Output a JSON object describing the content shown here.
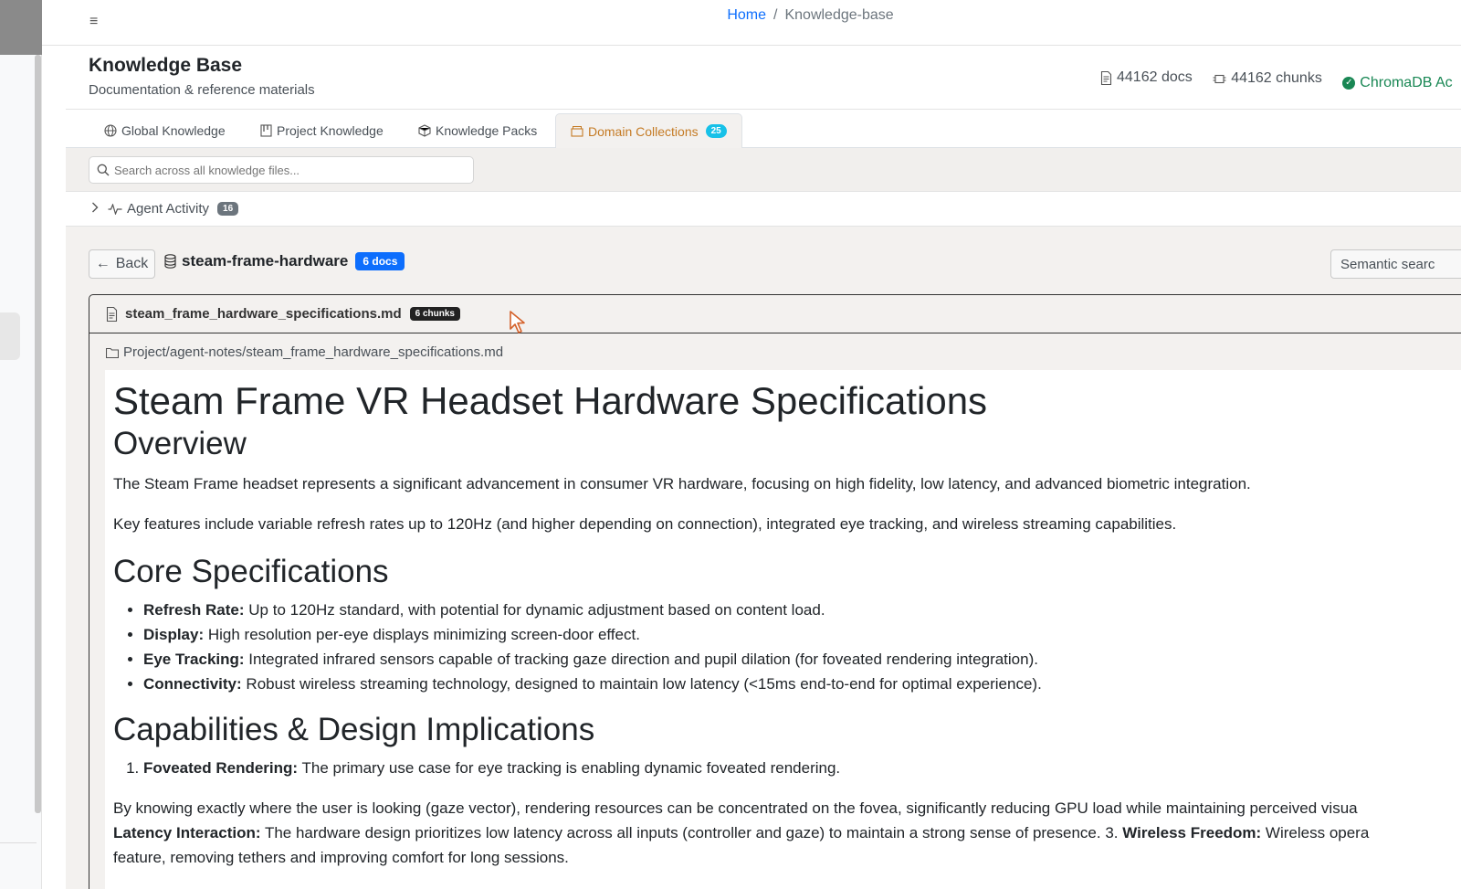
{
  "breadcrumb": {
    "home": "Home",
    "separator": "/",
    "current": "Knowledge-base"
  },
  "header": {
    "title": "Knowledge Base",
    "subtitle": "Documentation & reference materials",
    "docs_stat": "44162 docs",
    "chunks_stat": "44162 chunks",
    "chroma_status": "ChromaDB Ac",
    "status_color": "#198754"
  },
  "tabs": [
    {
      "label": "Global Knowledge",
      "icon": "globe-icon"
    },
    {
      "label": "Project Knowledge",
      "icon": "project-icon"
    },
    {
      "label": "Knowledge Packs",
      "icon": "package-icon"
    },
    {
      "label": "Domain Collections",
      "icon": "archive-icon",
      "count": "25",
      "active": true
    }
  ],
  "search": {
    "placeholder": "Search across all knowledge files..."
  },
  "agent_activity": {
    "label": "Agent Activity",
    "count": "16"
  },
  "collection": {
    "back_label": "Back",
    "name": "steam-frame-hardware",
    "docs_badge": "6 docs",
    "semantic_search_label": "Semantic searc"
  },
  "document": {
    "filename": "steam_frame_hardware_specifications.md",
    "chunks_badge": "6 chunks",
    "path": "Project/agent-notes/steam_frame_hardware_specifications.md",
    "h1": "Steam Frame VR Headset Hardware Specifications",
    "overview_heading": "Overview",
    "overview_p1": "The Steam Frame headset represents a significant advancement in consumer VR hardware, focusing on high fidelity, low latency, and advanced biometric integration.",
    "overview_p2": "Key features include variable refresh rates up to 120Hz (and higher depending on connection), integrated eye tracking, and wireless streaming capabilities.",
    "core_heading": "Core Specifications",
    "core_items": [
      {
        "term": "Refresh Rate:",
        "text": " Up to 120Hz standard, with potential for dynamic adjustment based on content load."
      },
      {
        "term": "Display:",
        "text": " High resolution per-eye displays minimizing screen-door effect."
      },
      {
        "term": "Eye Tracking:",
        "text": " Integrated infrared sensors capable of tracking gaze direction and pupil dilation (for foveated rendering integration)."
      },
      {
        "term": "Connectivity:",
        "text": " Robust wireless streaming technology, designed to maintain low latency (<15ms end-to-end for optimal experience)."
      }
    ],
    "cap_heading": "Capabilities & Design Implications",
    "cap_items": [
      {
        "term": "Foveated Rendering:",
        "text": " The primary use case for eye tracking is enabling dynamic foveated rendering."
      }
    ],
    "cap_p1": "By knowing exactly where the user is looking (gaze vector), rendering resources can be concentrated on the fovea, significantly reducing GPU load while maintaining perceived visua",
    "cap_p2_term1": "Latency Interaction:",
    "cap_p2_text1": " The hardware design prioritizes low latency across all inputs (controller and gaze) to maintain a strong sense of presence. 3. ",
    "cap_p2_term2": "Wireless Freedom:",
    "cap_p2_text2": " Wireless opera",
    "cap_p3": "feature, removing tethers and improving comfort for long sessions."
  }
}
